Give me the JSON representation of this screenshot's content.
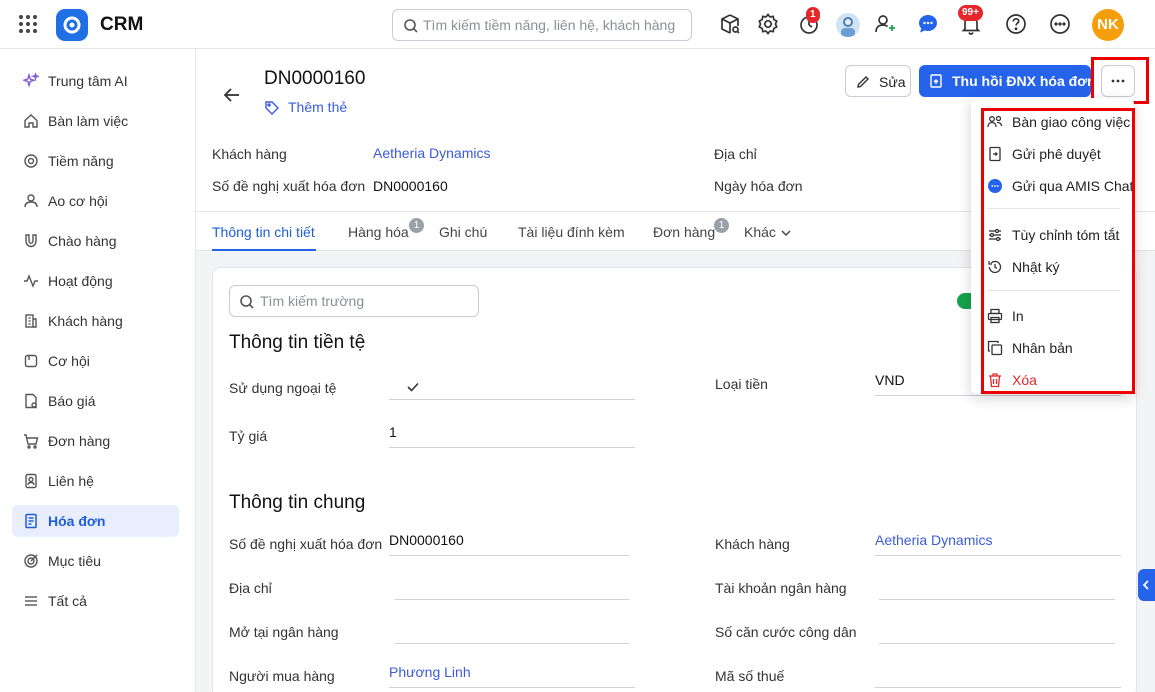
{
  "app": {
    "name": "CRM"
  },
  "search": {
    "placeholder": "Tìm kiếm tiềm năng, liên hệ, khách hàng"
  },
  "topbar": {
    "timer_badge": "1",
    "notif_badge": "99+",
    "user_initials": "NK",
    "icons": [
      "grid-icon",
      "package-search-icon",
      "gear-icon",
      "timer-icon",
      "avatar",
      "add-user-icon",
      "chat-icon",
      "bell-icon",
      "help-icon",
      "more-icon"
    ]
  },
  "sidebar": {
    "items": [
      {
        "label": "Trung tâm AI",
        "icon": "sparkle-icon"
      },
      {
        "label": "Bàn làm việc",
        "icon": "home-icon"
      },
      {
        "label": "Tiềm năng",
        "icon": "target-icon"
      },
      {
        "label": "Ao cơ hội",
        "icon": "users-icon"
      },
      {
        "label": "Chào hàng",
        "icon": "magnet-icon"
      },
      {
        "label": "Hoạt động",
        "icon": "activity-icon"
      },
      {
        "label": "Khách hàng",
        "icon": "building-icon"
      },
      {
        "label": "Cơ hội",
        "icon": "box-icon"
      },
      {
        "label": "Báo giá",
        "icon": "quote-icon"
      },
      {
        "label": "Đơn hàng",
        "icon": "cart-icon"
      },
      {
        "label": "Liên hệ",
        "icon": "contact-icon"
      },
      {
        "label": "Hóa đơn",
        "icon": "invoice-icon",
        "active": true
      },
      {
        "label": "Mục tiêu",
        "icon": "goal-icon"
      },
      {
        "label": "Tất cả",
        "icon": "menu-icon"
      }
    ]
  },
  "record": {
    "id": "DN0000160",
    "add_tag": "Thêm thẻ",
    "edit_label": "Sửa",
    "primary_label": "Thu hồi ĐNX hóa đơn",
    "summary": [
      {
        "label": "Khách hàng",
        "value": "Aetheria Dynamics"
      },
      {
        "label": "Số đề nghị xuất hóa đơn",
        "value": "DN0000160"
      },
      {
        "label": "Địa chỉ",
        "value": ""
      },
      {
        "label": "Ngày hóa đơn",
        "value": ""
      }
    ]
  },
  "tabs": [
    {
      "label": "Thông tin chi tiết",
      "active": true
    },
    {
      "label": "Hàng hóa",
      "badge": "1"
    },
    {
      "label": "Ghi chú"
    },
    {
      "label": "Tài liệu đính kèm"
    },
    {
      "label": "Đơn hàng",
      "badge": "1"
    },
    {
      "label": "Khác"
    }
  ],
  "detail": {
    "field_search_placeholder": "Tìm kiếm trường",
    "section_currency": "Thông tin tiền tệ",
    "section_general": "Thông tin chung",
    "currency_fields": {
      "use_foreign_label": "Sử dụng ngoại tệ",
      "currency_label": "Loại tiền",
      "currency_value": "VND",
      "rate_label": "Tỷ giá",
      "rate_value": "1"
    },
    "general_fields": {
      "req_no_label": "Số đề nghị xuất hóa đơn",
      "req_no_value": "DN0000160",
      "customer_label": "Khách hàng",
      "customer_value": "Aetheria Dynamics",
      "address_label": "Địa chỉ",
      "bank_account_label": "Tài khoản ngân hàng",
      "bank_open_label": "Mở tại ngân hàng",
      "id_card_label": "Số căn cước công dân",
      "buyer_label": "Người mua hàng",
      "buyer_value": "Phương Linh",
      "tax_label": "Mã số thuế"
    }
  },
  "dropdown": {
    "items": [
      {
        "label": "Bàn giao công việc",
        "icon": "handover-icon"
      },
      {
        "label": "Gửi phê duyệt",
        "icon": "approve-icon"
      },
      {
        "label": "Gửi qua AMIS Chat",
        "icon": "chat-icon"
      },
      {
        "label": "Tùy chỉnh tóm tắt",
        "icon": "sliders-icon"
      },
      {
        "label": "Nhật ký",
        "icon": "history-icon"
      },
      {
        "label": "In",
        "icon": "printer-icon"
      },
      {
        "label": "Nhân bản",
        "icon": "duplicate-icon"
      },
      {
        "label": "Xóa",
        "icon": "trash-icon",
        "danger": true
      }
    ]
  },
  "colors": {
    "accent": "#2563eb",
    "danger": "#e5262b",
    "highlight": "#ee0000"
  }
}
